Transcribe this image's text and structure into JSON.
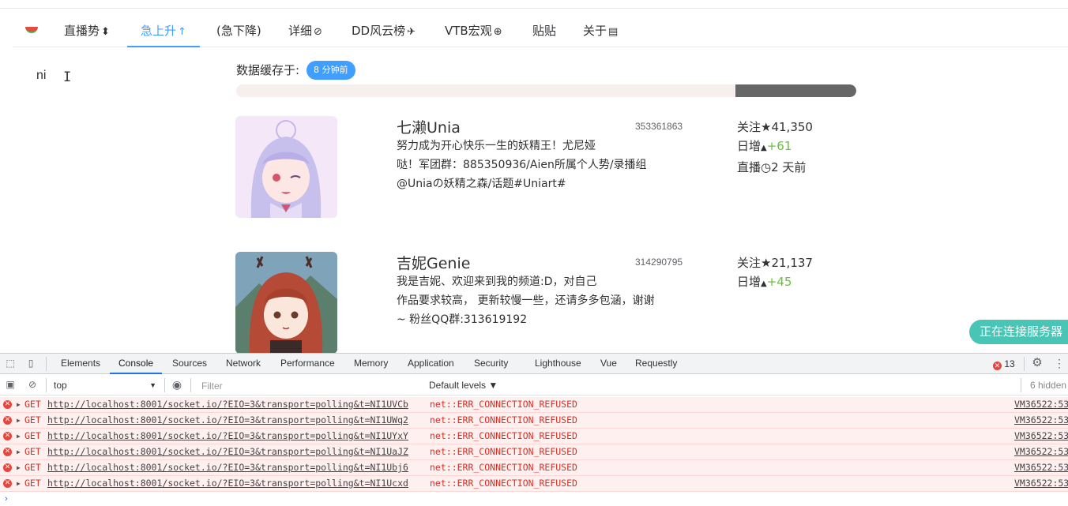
{
  "nav": {
    "items": [
      {
        "label": "直播势",
        "icon": "⬍"
      },
      {
        "label": "急上升",
        "icon": "↑"
      },
      {
        "label": "(急下降)",
        "icon": ""
      },
      {
        "label": "详细",
        "icon": "⊘"
      },
      {
        "label": "DD风云榜",
        "icon": "✈"
      },
      {
        "label": "VTB宏观",
        "icon": "⊕"
      },
      {
        "label": "贴贴",
        "icon": ""
      },
      {
        "label": "关于",
        "icon": "▤"
      }
    ],
    "active_index": 1
  },
  "search": {
    "value": "ni"
  },
  "cache": {
    "label": "数据缓存于:",
    "badge": "8 分钟前"
  },
  "progress": {
    "percent": 19.5
  },
  "vtbs": [
    {
      "name": "七濑Unia",
      "mid": "353361863",
      "sign_lines": [
        "努力成为开心快乐一生的妖精王！尤尼娅",
        "哒！军团群：885350936/Aien所属个人势/录播组",
        "@Uniaの妖精之森/话题#Uniart#"
      ],
      "follow_label": "关注",
      "follow_icon": "★",
      "follow": "41,350",
      "daily_label": "日增",
      "daily_icon": "▲",
      "daily": "+61",
      "live_label": "直播",
      "live_icon": "◷",
      "live": "2 天前"
    },
    {
      "name": "吉妮Genie",
      "mid": "314290795",
      "sign_lines": [
        "我是吉妮、欢迎来到我的频道:D，对自己",
        "作品要求较高， 更新较慢一些，还请多多包涵，谢谢",
        "~ 粉丝QQ群:313619192"
      ],
      "follow_label": "关注",
      "follow_icon": "★",
      "follow": "21,137",
      "daily_label": "日增",
      "daily_icon": "▲",
      "daily": "+45"
    }
  ],
  "connecting": "正在连接服务器",
  "devtools": {
    "tabs": [
      "Elements",
      "Console",
      "Sources",
      "Network",
      "Performance",
      "Memory",
      "Application",
      "Security",
      "Lighthouse",
      "Vue",
      "Requestly"
    ],
    "active_tab": "Console",
    "error_count": "13",
    "context": "top",
    "filter_placeholder": "Filter",
    "levels": "Default levels ▼",
    "hidden": "6 hidden",
    "logs": [
      {
        "method": "GET",
        "url": "http://localhost:8001/socket.io/?EIO=3&transport=polling&t=NI1UVCb",
        "error": "net::ERR_CONNECTION_REFUSED",
        "source": "VM36522:53"
      },
      {
        "method": "GET",
        "url": "http://localhost:8001/socket.io/?EIO=3&transport=polling&t=NI1UWq2",
        "error": "net::ERR_CONNECTION_REFUSED",
        "source": "VM36522:53"
      },
      {
        "method": "GET",
        "url": "http://localhost:8001/socket.io/?EIO=3&transport=polling&t=NI1UYxY",
        "error": "net::ERR_CONNECTION_REFUSED",
        "source": "VM36522:53"
      },
      {
        "method": "GET",
        "url": "http://localhost:8001/socket.io/?EIO=3&transport=polling&t=NI1UaJZ",
        "error": "net::ERR_CONNECTION_REFUSED",
        "source": "VM36522:53"
      },
      {
        "method": "GET",
        "url": "http://localhost:8001/socket.io/?EIO=3&transport=polling&t=NI1Ubj6",
        "error": "net::ERR_CONNECTION_REFUSED",
        "source": "VM36522:53"
      },
      {
        "method": "GET",
        "url": "http://localhost:8001/socket.io/?EIO=3&transport=polling&t=NI1Ucxd",
        "error": "net::ERR_CONNECTION_REFUSED",
        "source": "VM36522:53"
      }
    ]
  }
}
